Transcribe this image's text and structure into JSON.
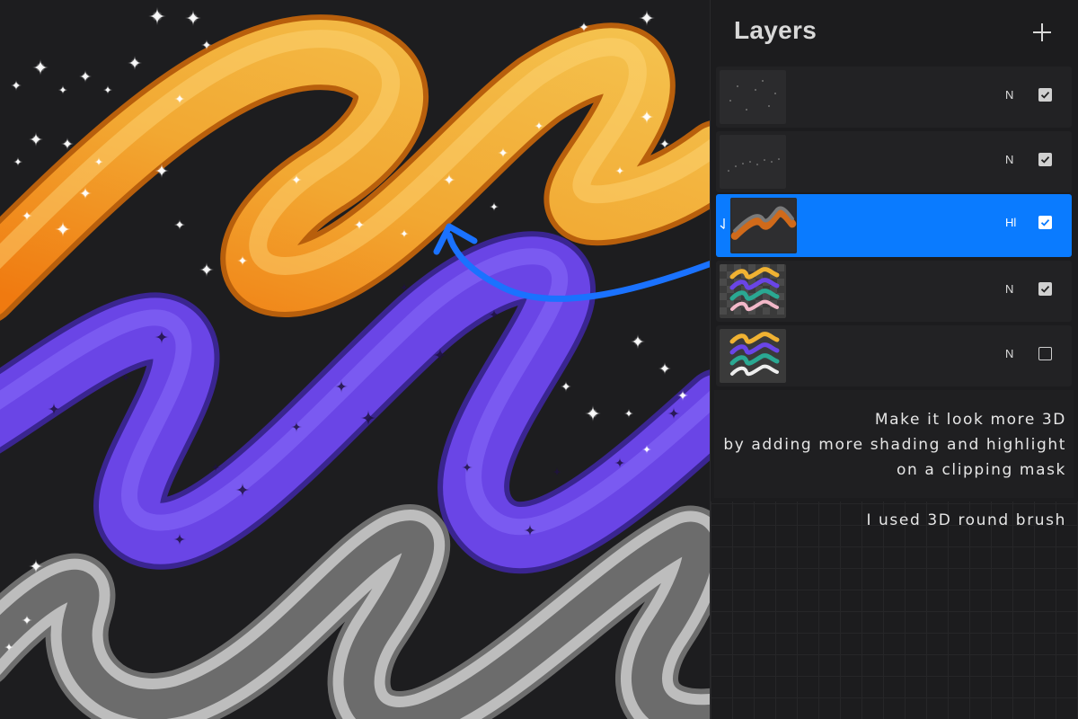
{
  "panel": {
    "title": "Layers",
    "add_label": "+"
  },
  "layers": [
    {
      "blend": "N",
      "visible": true,
      "selected": false,
      "thumb": "sparkles-small"
    },
    {
      "blend": "N",
      "visible": true,
      "selected": false,
      "thumb": "sparkles-dots"
    },
    {
      "blend": "Hl",
      "visible": true,
      "selected": true,
      "thumb": "orange-highlight",
      "clipping_mask": true
    },
    {
      "blend": "N",
      "visible": true,
      "selected": false,
      "thumb": "colored-strokes"
    },
    {
      "blend": "N",
      "visible": false,
      "selected": false,
      "thumb": "colored-strokes"
    }
  ],
  "notes": {
    "line1": "Make it look more 3D",
    "line2": "by adding more shading and highlight",
    "line3": "on a clipping mask",
    "line4": "I used 3D round brush"
  },
  "colors": {
    "accent": "#0a7bff",
    "gold": "#f2b63a",
    "orange": "#f07a10",
    "purple": "#6a45e6",
    "silver": "#cfcfcf",
    "background": "#1d1d1f"
  }
}
